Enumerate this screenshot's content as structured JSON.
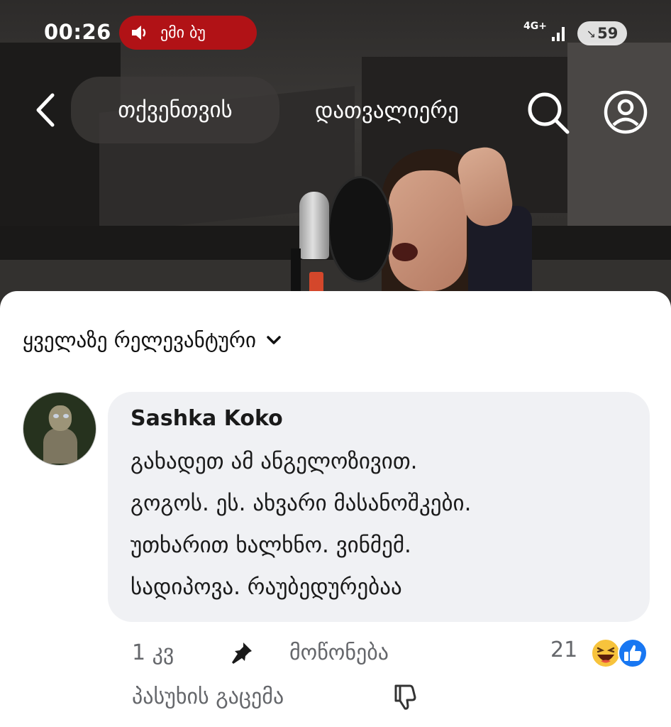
{
  "status_bar": {
    "time": "00:26",
    "call_label": "ემი  ბუ",
    "network": "4G+",
    "battery_level": "59",
    "call_pill_color": "#b11216"
  },
  "nav": {
    "tab_for_you": "თქვენთვის",
    "tab_explore": "დათვალიერე",
    "icons": [
      "chevron-left-icon",
      "search-icon",
      "profile-icon"
    ]
  },
  "comments": {
    "sort_label": "ყველაზე რელევანტური",
    "items": [
      {
        "author": "Sashka Koko",
        "lines": [
          "გახადეთ ამ ანგელოზივით.",
          "გოგოს. ეს. ახვარი მასანოშკები.",
          "უთხარით ხალხნო. ვინმემ.",
          "სადიპოვა. რაუბედურებაა"
        ],
        "time_ago": "1 კვ",
        "like_label": "მოწონება",
        "reply_label": "პასუხის გაცემა",
        "reaction_count": "21",
        "reactions": [
          "haha-icon",
          "like-icon"
        ]
      }
    ]
  },
  "colors": {
    "bubble": "#f0f1f4",
    "secondary_text": "#65676b",
    "like_blue": "#1877f2"
  }
}
